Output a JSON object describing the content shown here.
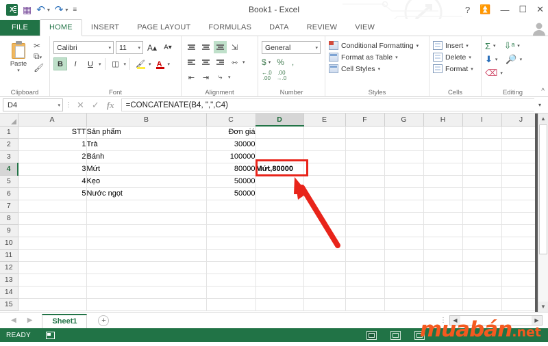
{
  "titlebar": {
    "document_title": "Book1 - Excel",
    "qat": [
      {
        "name": "excel-logo",
        "glyph": "X"
      },
      {
        "name": "save-icon",
        "glyph": "▤"
      },
      {
        "name": "undo-icon",
        "glyph": "↶"
      },
      {
        "name": "redo-icon",
        "glyph": "↷"
      },
      {
        "name": "customize-qat-icon",
        "glyph": "≡"
      }
    ],
    "help": "?",
    "ribbon_display_options": "⬆",
    "minimize": "—",
    "maximize": "❐",
    "close": "✕"
  },
  "tabs": [
    {
      "label": "FILE",
      "active": false
    },
    {
      "label": "HOME",
      "active": true
    },
    {
      "label": "INSERT",
      "active": false
    },
    {
      "label": "PAGE LAYOUT",
      "active": false
    },
    {
      "label": "FORMULAS",
      "active": false
    },
    {
      "label": "DATA",
      "active": false
    },
    {
      "label": "REVIEW",
      "active": false
    },
    {
      "label": "VIEW",
      "active": false
    }
  ],
  "ribbon": {
    "clipboard": {
      "label": "Clipboard",
      "paste_label": "Paste",
      "paste_caret": "▾",
      "cut": "✂",
      "copy": "❐",
      "format_painter": "✎",
      "copy_caret": "▾",
      "dialog_launcher": "⤵"
    },
    "font": {
      "label": "Font",
      "font_name": "Calibri",
      "font_size": "11",
      "grow_font": "A",
      "shrink_font": "A",
      "bold": "B",
      "italic": "I",
      "underline": "U",
      "underline_caret": "▾",
      "borders": "⊞",
      "borders_caret": "▾",
      "fill_color": "⬟",
      "fill_caret": "▾",
      "font_color": "A",
      "font_color_caret": "▾",
      "dialog_launcher": "⤵"
    },
    "alignment": {
      "label": "Alignment",
      "align_top": "",
      "align_middle": "",
      "align_bottom": "",
      "orientation": "⤴",
      "align_left": "",
      "align_center": "",
      "align_right": "",
      "wrap_text": "↔",
      "merge_caret": "▾",
      "decrease_indent": "⇤",
      "increase_indent": "⇥",
      "merge_center": "⤧",
      "dialog_launcher": "⤵"
    },
    "number": {
      "label": "Number",
      "format": "General",
      "accounting": "$",
      "accounting_caret": "▾",
      "percent": "%",
      "comma": ",",
      "increase_decimal": "←.0\n.00",
      "decrease_decimal": ".00\n→.0",
      "increase_decimal_top": "←.0",
      "increase_decimal_bot": ".00",
      "decrease_decimal_top": ".00",
      "decrease_decimal_bot": "→.0",
      "dialog_launcher": "⤵"
    },
    "styles": {
      "label": "Styles",
      "items": [
        {
          "label": "Conditional Formatting",
          "caret": "▾"
        },
        {
          "label": "Format as Table",
          "caret": "▾"
        },
        {
          "label": "Cell Styles",
          "caret": "▾"
        }
      ]
    },
    "cells": {
      "label": "Cells",
      "items": [
        {
          "label": "Insert",
          "caret": "▾"
        },
        {
          "label": "Delete",
          "caret": "▾"
        },
        {
          "label": "Format",
          "caret": "▾"
        }
      ]
    },
    "editing": {
      "label": "Editing",
      "autosum": "Σ",
      "autosum_caret": "▾",
      "sort_filter": "A↓",
      "sort_caret": "▾",
      "fill": "⬇",
      "fill_caret": "▾",
      "find_select": "⚲",
      "find_caret": "▾",
      "clear": "⌫",
      "clear_caret": "▾"
    },
    "collapse_ribbon": "∧"
  },
  "formula_bar": {
    "name_box": "D4",
    "name_box_caret": "▾",
    "cancel": "✕",
    "enter": "✓",
    "insert_function": "fx",
    "formula": "=CONCATENATE(B4, \",\",C4)",
    "expand_caret": "▾"
  },
  "grid": {
    "columns": [
      "A",
      "B",
      "C",
      "D",
      "E",
      "F",
      "G",
      "H",
      "I",
      "J"
    ],
    "selected_column": "D",
    "selected_row": 4,
    "rows": [
      {
        "num": "1",
        "cells": {
          "A": "STT",
          "B": "Sản phẩm",
          "C": "Đơn giá",
          "D": ""
        }
      },
      {
        "num": "2",
        "cells": {
          "A": "1",
          "B": "Trà",
          "C": "30000",
          "D": ""
        }
      },
      {
        "num": "3",
        "cells": {
          "A": "2",
          "B": "Bánh",
          "C": "100000",
          "D": ""
        }
      },
      {
        "num": "4",
        "cells": {
          "A": "3",
          "B": "Mứt",
          "C": "80000",
          "D": "Mứt,80000"
        }
      },
      {
        "num": "5",
        "cells": {
          "A": "4",
          "B": "Kẹo",
          "C": "50000",
          "D": ""
        }
      },
      {
        "num": "6",
        "cells": {
          "A": "5",
          "B": "Nước ngọt",
          "C": "50000",
          "D": ""
        }
      },
      {
        "num": "7",
        "cells": {
          "A": "",
          "B": "",
          "C": "",
          "D": ""
        }
      },
      {
        "num": "8",
        "cells": {
          "A": "",
          "B": "",
          "C": "",
          "D": ""
        }
      },
      {
        "num": "9",
        "cells": {
          "A": "",
          "B": "",
          "C": "",
          "D": ""
        }
      },
      {
        "num": "10",
        "cells": {
          "A": "",
          "B": "",
          "C": "",
          "D": ""
        }
      },
      {
        "num": "11",
        "cells": {
          "A": "",
          "B": "",
          "C": "",
          "D": ""
        }
      },
      {
        "num": "12",
        "cells": {
          "A": "",
          "B": "",
          "C": "",
          "D": ""
        }
      },
      {
        "num": "13",
        "cells": {
          "A": "",
          "B": "",
          "C": "",
          "D": ""
        }
      },
      {
        "num": "14",
        "cells": {
          "A": "",
          "B": "",
          "C": "",
          "D": ""
        }
      },
      {
        "num": "15",
        "cells": {
          "A": "",
          "B": "",
          "C": "",
          "D": ""
        }
      }
    ],
    "numeric_right_aligned_columns": [
      "A",
      "C"
    ],
    "scroll_up": "▲",
    "scroll_down": "▼"
  },
  "annotations": {
    "highlight_cell": "D4",
    "highlight_color": "#e8241a",
    "arrow_color": "#e8241a"
  },
  "sheet_bar": {
    "prev": "◀",
    "next": "▶",
    "tabs": [
      {
        "label": "Sheet1",
        "active": true
      }
    ],
    "add_sheet": "⊕",
    "h_scroll_left": "◀",
    "h_scroll_right": "▶",
    "dots": "⋮"
  },
  "status_bar": {
    "state": "READY",
    "macro_record": "record-macro-icon",
    "views": [
      {
        "name": "normal-view",
        "active": true
      },
      {
        "name": "page-layout-view",
        "active": false
      },
      {
        "name": "page-break-preview",
        "active": false
      }
    ]
  },
  "watermark": {
    "brand": "muabán",
    "tld": ".net",
    "color": "#f4591f"
  }
}
